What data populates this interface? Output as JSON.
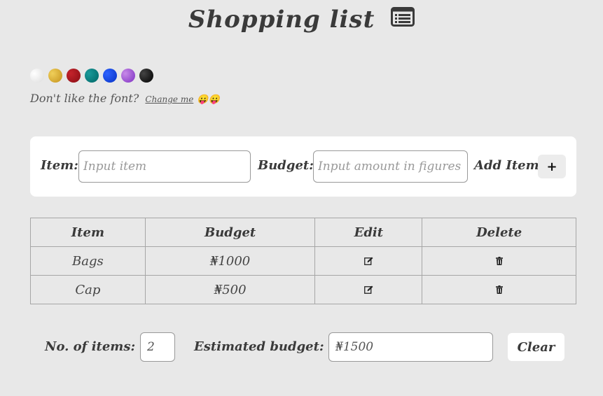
{
  "header": {
    "title": "Shopping list",
    "icon": "list-icon"
  },
  "theme_swatches": [
    {
      "name": "white",
      "color": "#f2f2f2"
    },
    {
      "name": "gold",
      "color": "#d4a62a"
    },
    {
      "name": "red",
      "color": "#a3151c"
    },
    {
      "name": "teal",
      "color": "#008080"
    },
    {
      "name": "blue",
      "color": "#0a3fe0"
    },
    {
      "name": "purple",
      "color": "#9b46d6"
    },
    {
      "name": "black",
      "color": "#111111"
    }
  ],
  "font_toggle": {
    "prompt": "Don't like the font?",
    "link": "Change me",
    "emoji": "😛😛"
  },
  "form": {
    "item_label": "Item:",
    "item_placeholder": "Input item",
    "budget_label": "Budget:",
    "budget_placeholder": "Input amount in figures",
    "add_label": "Add Item",
    "add_button": "+"
  },
  "table": {
    "headers": [
      "Item",
      "Budget",
      "Edit",
      "Delete"
    ],
    "rows": [
      {
        "item": "Bags",
        "budget": "₦1000"
      },
      {
        "item": "Cap",
        "budget": "₦500"
      }
    ],
    "edit_icon": "edit-icon",
    "delete_icon": "trash-icon"
  },
  "summary": {
    "count_label": "No. of items:",
    "count_value": "2",
    "budget_label": "Estimated budget:",
    "budget_value": "₦1500",
    "clear_button": "Clear"
  }
}
